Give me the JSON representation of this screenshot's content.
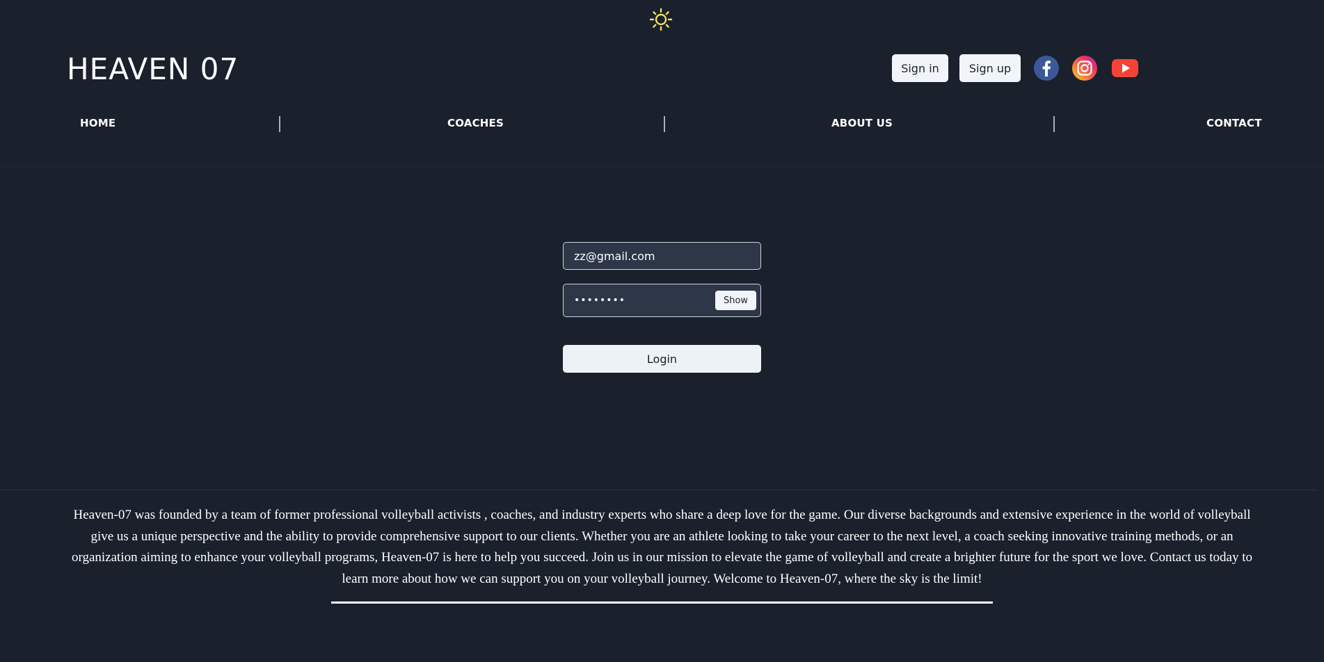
{
  "brand": {
    "logo_text": "HEAVEN 07"
  },
  "header": {
    "theme_toggle_icon": "sun-icon",
    "signin_label": "Sign in",
    "signup_label": "Sign up",
    "social": [
      {
        "name": "facebook-icon",
        "color": "#3b5998"
      },
      {
        "name": "instagram-icon",
        "color": "#e1306c"
      },
      {
        "name": "youtube-icon",
        "color": "#ff0000"
      }
    ]
  },
  "nav": {
    "items": [
      {
        "label": "HOME"
      },
      {
        "label": "COACHES"
      },
      {
        "label": "ABOUT US"
      },
      {
        "label": "CONTACT"
      }
    ]
  },
  "login": {
    "email_value": "zz@gmail.com",
    "password_masked": "••••••••",
    "show_label": "Show",
    "login_label": "Login"
  },
  "footer": {
    "about_text": "Heaven-07 was founded by a team of former professional volleyball activists , coaches, and industry experts who share a deep love for the game. Our diverse backgrounds and extensive experience in the world of volleyball give us a unique perspective and the ability to provide comprehensive support to our clients. Whether you are an athlete looking to take your career to the next level, a coach seeking innovative training methods, or an organization aiming to enhance your volleyball programs, Heaven-07 is here to help you succeed. Join us in our mission to elevate the game of volleyball and create a brighter future for the sport we love. Contact us today to learn more about how we can support you on your volleyball journey. Welcome to Heaven-07, where the sky is the limit!"
  },
  "colors": {
    "background": "#1a202c",
    "input_background": "#2d3748",
    "button_light": "#f1f5f9",
    "sun": "#f6e05e"
  }
}
